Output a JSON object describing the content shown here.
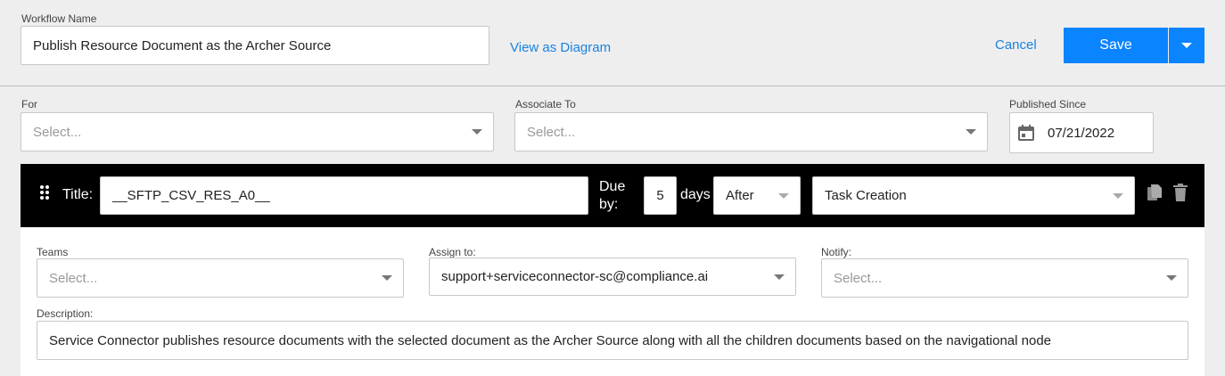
{
  "header": {
    "workflow_name_label": "Workflow Name",
    "workflow_name_value": "Publish Resource Document as the Archer Source",
    "view_diagram_link": "View as Diagram",
    "cancel_label": "Cancel",
    "save_label": "Save"
  },
  "filters": {
    "for_label": "For",
    "for_placeholder": "Select...",
    "associate_label": "Associate To",
    "associate_placeholder": "Select...",
    "published_label": "Published Since",
    "published_value": "07/21/2022"
  },
  "task": {
    "title_label": "Title:",
    "title_value": "__SFTP_CSV_RES_A0__",
    "due_label_1": "Due",
    "due_label_2": "by:",
    "due_days_value": "5",
    "days_label": "days",
    "relation_value": "After",
    "event_value": "Task Creation",
    "teams_label": "Teams",
    "teams_placeholder": "Select...",
    "assign_label": "Assign to:",
    "assign_value": "support+serviceconnector-sc@compliance.ai",
    "notify_label": "Notify:",
    "notify_placeholder": "Select...",
    "description_label": "Description:",
    "description_value": "Service Connector publishes resource documents with the selected document as the Archer Source along with all the children documents based on the navigational node"
  },
  "colors": {
    "accent": "#0a84ff",
    "link": "#1a82e2",
    "taskbar": "#000000"
  },
  "icons": [
    "calendar-icon",
    "drag-handle-icon",
    "copy-icon",
    "trash-icon",
    "chevron-down-icon"
  ]
}
